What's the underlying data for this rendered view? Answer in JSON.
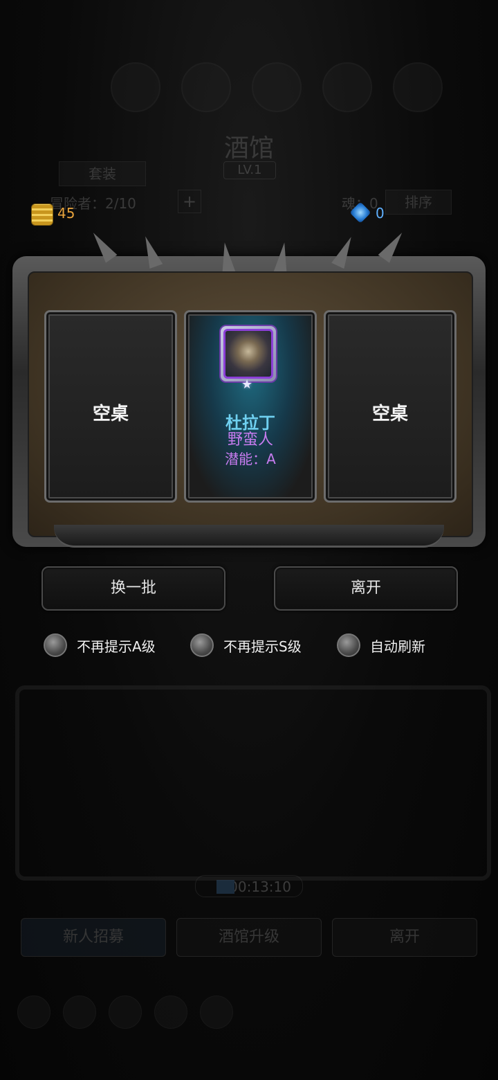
{
  "background": {
    "title": "酒馆",
    "level": "LV.1",
    "set_button": "套装",
    "adventurers": "冒险者：2/10",
    "plus": "+",
    "soul": "魂：0",
    "sort_button": "排序",
    "timer": "00:13:10",
    "bottom_buttons": [
      "新人招募",
      "酒馆升级",
      "离开"
    ]
  },
  "currency": {
    "gold": "45",
    "gems": "0",
    "gold_icon": "gold-coin-stack-icon",
    "gem_icon": "blue-gem-icon"
  },
  "tables": [
    {
      "label": "空桌"
    },
    {
      "name": "杜拉丁",
      "class": "野蛮人",
      "potential": "潜能：A",
      "star": "★"
    },
    {
      "label": "空桌"
    }
  ],
  "actions": {
    "refresh": "换一批",
    "leave": "离开"
  },
  "options": [
    {
      "label": "不再提示A级"
    },
    {
      "label": "不再提示S级"
    },
    {
      "label": "自动刷新"
    }
  ],
  "colors": {
    "hero_name": "#6fd0f0",
    "hero_class": "#c87cf0",
    "gold_text": "#e8a33c",
    "gem_text": "#5fb0ff"
  }
}
